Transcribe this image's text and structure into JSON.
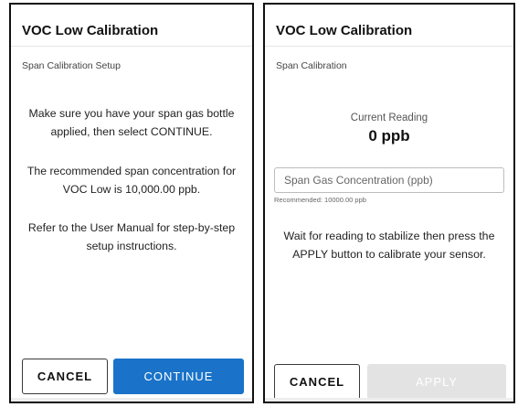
{
  "left_screen": {
    "title": "VOC Low Calibration",
    "subtitle": "Span Calibration Setup",
    "instructions": [
      "Make sure you have your span gas bottle applied, then select CONTINUE.",
      "The recommended span concentration for VOC Low is 10,000.00 ppb.",
      "Refer to the User Manual for step-by-step setup instructions."
    ],
    "cancel_label": "CANCEL",
    "continue_label": "CONTINUE"
  },
  "right_screen": {
    "title": "VOC Low Calibration",
    "subtitle": "Span Calibration",
    "reading_label": "Current Reading",
    "reading_value": "0 ppb",
    "concentration_placeholder": "Span Gas Concentration (ppb)",
    "concentration_value": "",
    "helper_text": "Recommended: 10000.00 ppb",
    "instruction": "Wait for reading to stabilize then press the APPLY button to calibrate your sensor.",
    "cancel_label": "CANCEL",
    "apply_label": "APPLY"
  },
  "colors": {
    "primary_button": "#1a73c9",
    "disabled_button": "#e3e3e3",
    "panel_border": "#111111"
  }
}
